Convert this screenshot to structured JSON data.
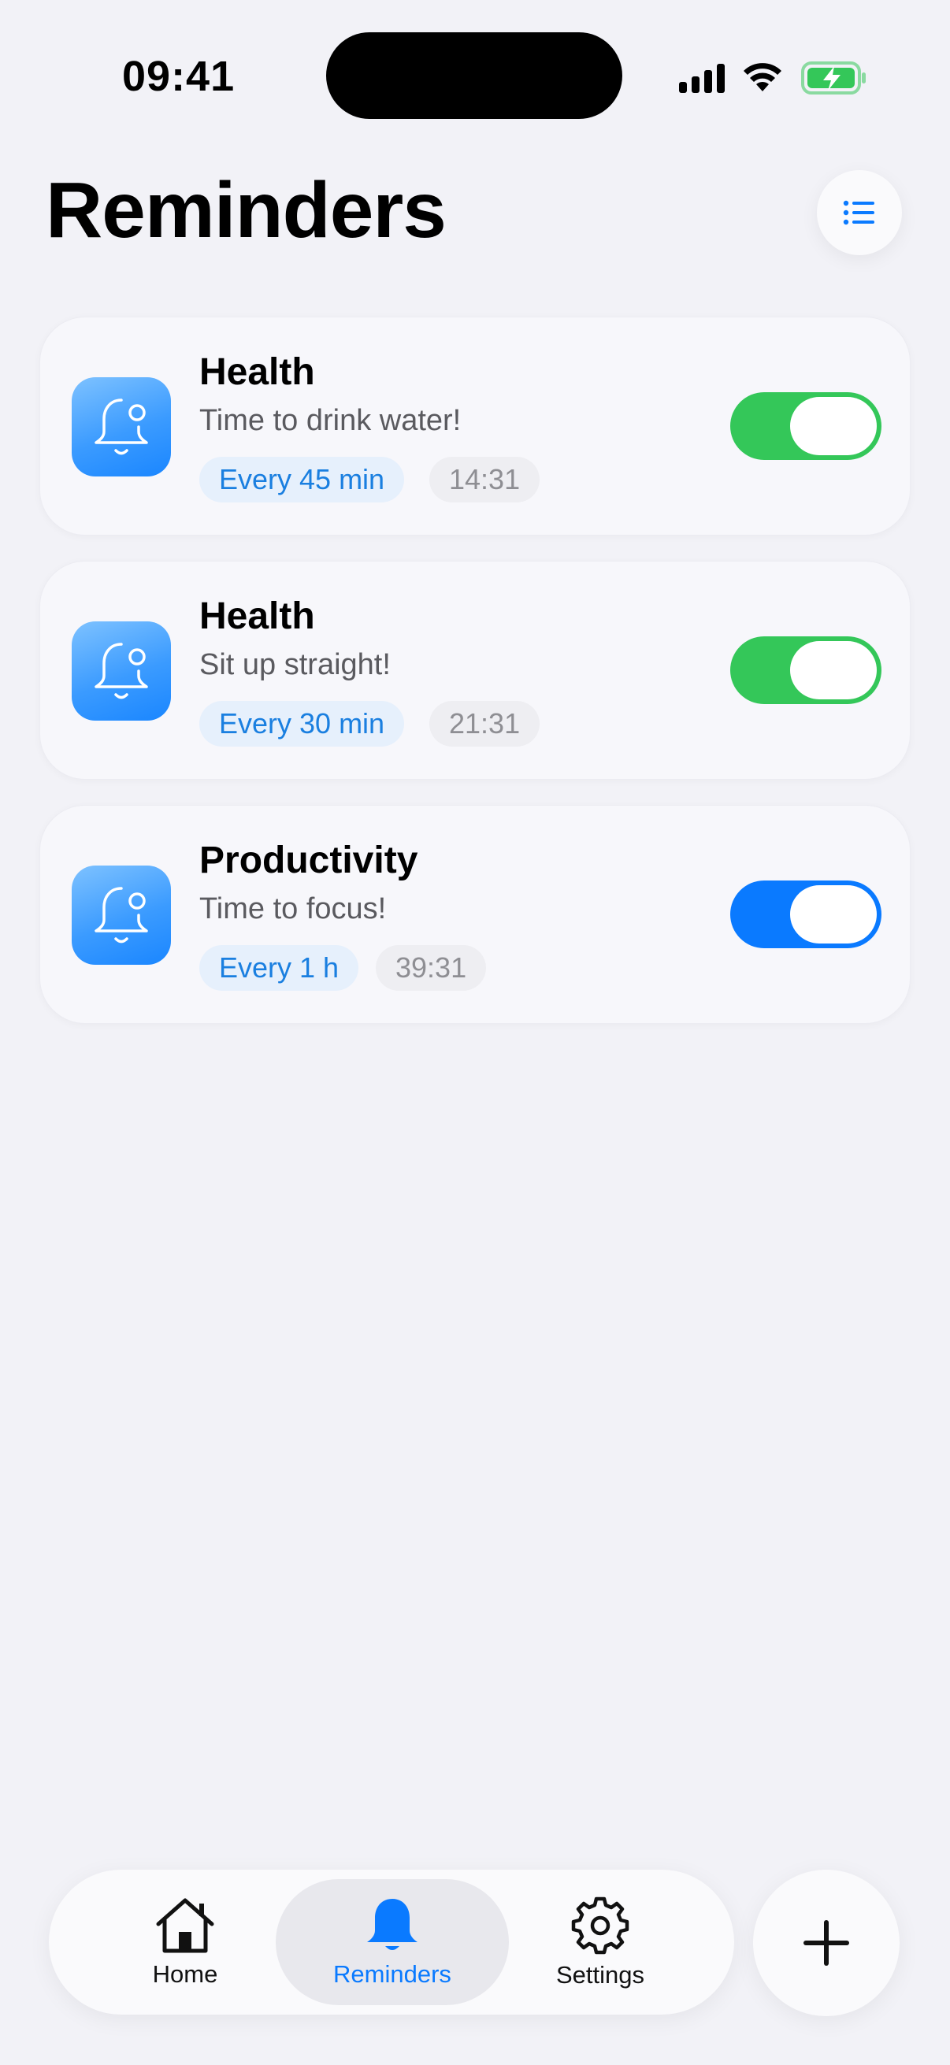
{
  "status_bar": {
    "time": "09:41"
  },
  "header": {
    "title": "Reminders"
  },
  "reminders": [
    {
      "category": "Health",
      "message": "Time to drink water!",
      "interval": "Every 45 min",
      "countdown": "14:31",
      "enabled": true,
      "toggle_color": "#34c759"
    },
    {
      "category": "Health",
      "message": "Sit up straight!",
      "interval": "Every 30 min",
      "countdown": "21:31",
      "enabled": true,
      "toggle_color": "#34c759"
    },
    {
      "category": "Productivity",
      "message": "Time to focus!",
      "interval": "Every 1 h",
      "countdown": "39:31",
      "enabled": true,
      "toggle_color": "#0a7aff"
    }
  ],
  "tabbar": {
    "tabs": [
      {
        "label": "Home",
        "icon": "house-icon",
        "active": false
      },
      {
        "label": "Reminders",
        "icon": "bell-icon",
        "active": true
      },
      {
        "label": "Settings",
        "icon": "gear-icon",
        "active": false
      }
    ],
    "active_color": "#0a7aff"
  },
  "add_button": {
    "icon": "plus-icon"
  }
}
